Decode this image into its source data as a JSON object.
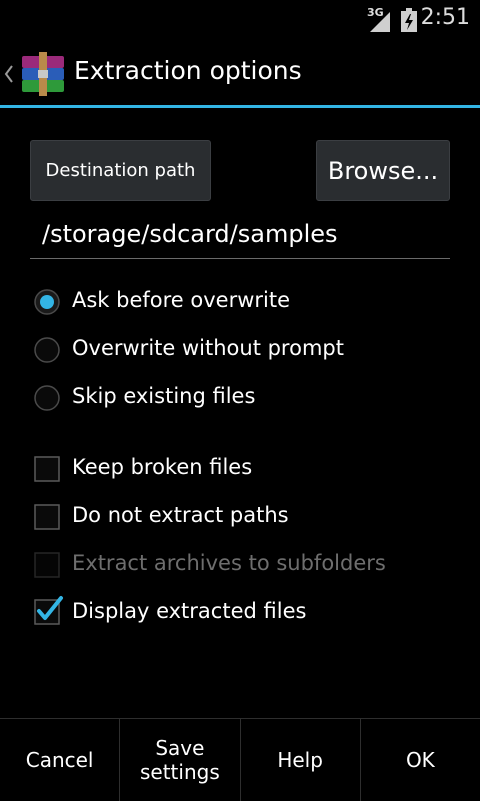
{
  "status_bar": {
    "network": "3G",
    "time": "2:51"
  },
  "action_bar": {
    "title": "Extraction options",
    "logo_icon": "winrar-books-icon",
    "accent_color": "#33b5e5"
  },
  "destination": {
    "label": "Destination path",
    "browse_label": "Browse...",
    "path_value": "/storage/sdcard/samples"
  },
  "overwrite_options": [
    {
      "label": "Ask before overwrite",
      "selected": true
    },
    {
      "label": "Overwrite without prompt",
      "selected": false
    },
    {
      "label": "Skip existing files",
      "selected": false
    }
  ],
  "checkbox_options": [
    {
      "label": "Keep broken files",
      "checked": false,
      "enabled": true
    },
    {
      "label": "Do not extract paths",
      "checked": false,
      "enabled": true
    },
    {
      "label": "Extract archives to subfolders",
      "checked": false,
      "enabled": false
    },
    {
      "label": "Display extracted files",
      "checked": true,
      "enabled": true
    }
  ],
  "bottom_buttons": {
    "cancel": "Cancel",
    "save_settings": "Save\nsettings",
    "help": "Help",
    "ok": "OK"
  }
}
